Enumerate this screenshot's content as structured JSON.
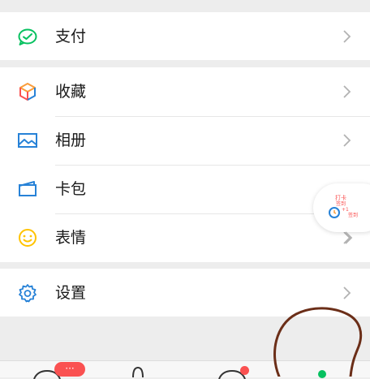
{
  "menu": {
    "pay": {
      "label": "支付",
      "icon": "wallet-icon"
    },
    "favorites": {
      "label": "收藏",
      "icon": "cube-icon"
    },
    "album": {
      "label": "相册",
      "icon": "image-icon"
    },
    "cards": {
      "label": "卡包",
      "icon": "card-icon"
    },
    "stickers": {
      "label": "表情",
      "icon": "smiley-icon"
    },
    "settings": {
      "label": "设置",
      "icon": "gear-icon"
    }
  },
  "floating_widget": {
    "lines": [
      "打卡",
      "签到",
      "+1",
      "签到"
    ],
    "icon": "clock-badge-icon"
  },
  "tabbar": {
    "chats_badge": "···",
    "tabs": [
      "chats-tab-icon",
      "contacts-tab-icon",
      "discover-tab-icon",
      "me-tab-icon"
    ]
  },
  "colors": {
    "green": "#07c160",
    "orange": "#fa9d3b",
    "blue": "#2782d7",
    "yellow": "#ffc300",
    "red": "#fa5151",
    "annotation": "#6b2e18"
  }
}
